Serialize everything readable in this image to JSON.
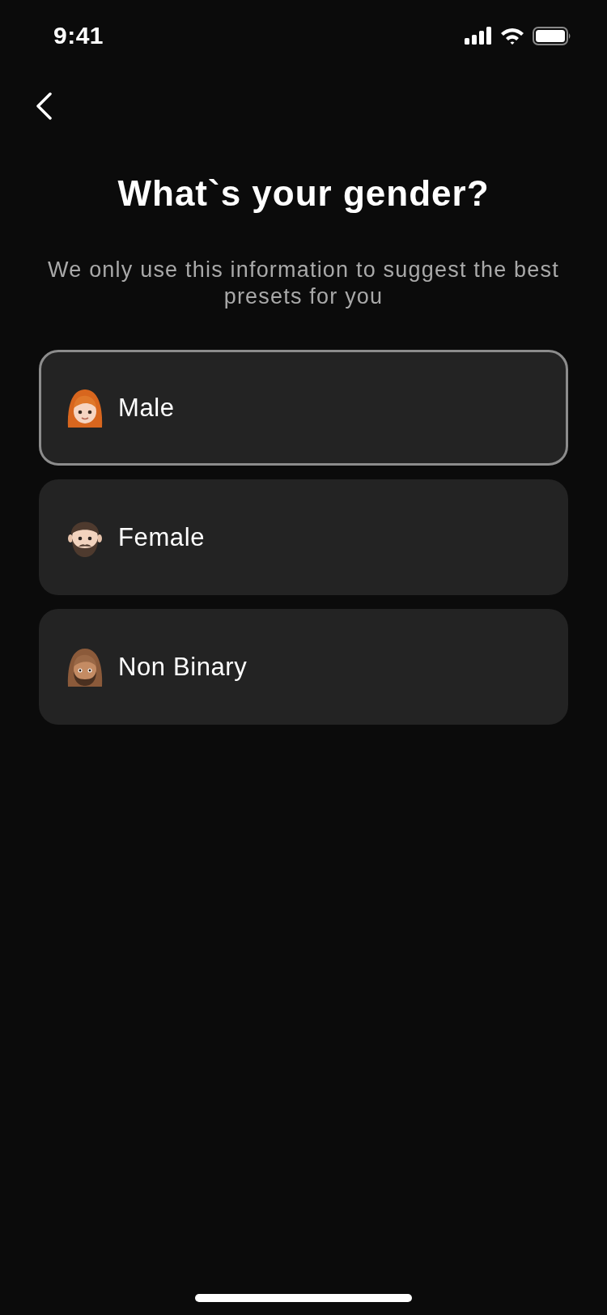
{
  "status_bar": {
    "time": "9:41"
  },
  "title": "What`s your gender?",
  "subtitle": "We only use this information to suggest the best presets for you",
  "options": [
    {
      "label": "Male",
      "kind": "woman",
      "selected": true
    },
    {
      "label": "Female",
      "kind": "man",
      "selected": false
    },
    {
      "label": "Non Binary",
      "kind": "bearded-woman",
      "selected": false
    }
  ]
}
